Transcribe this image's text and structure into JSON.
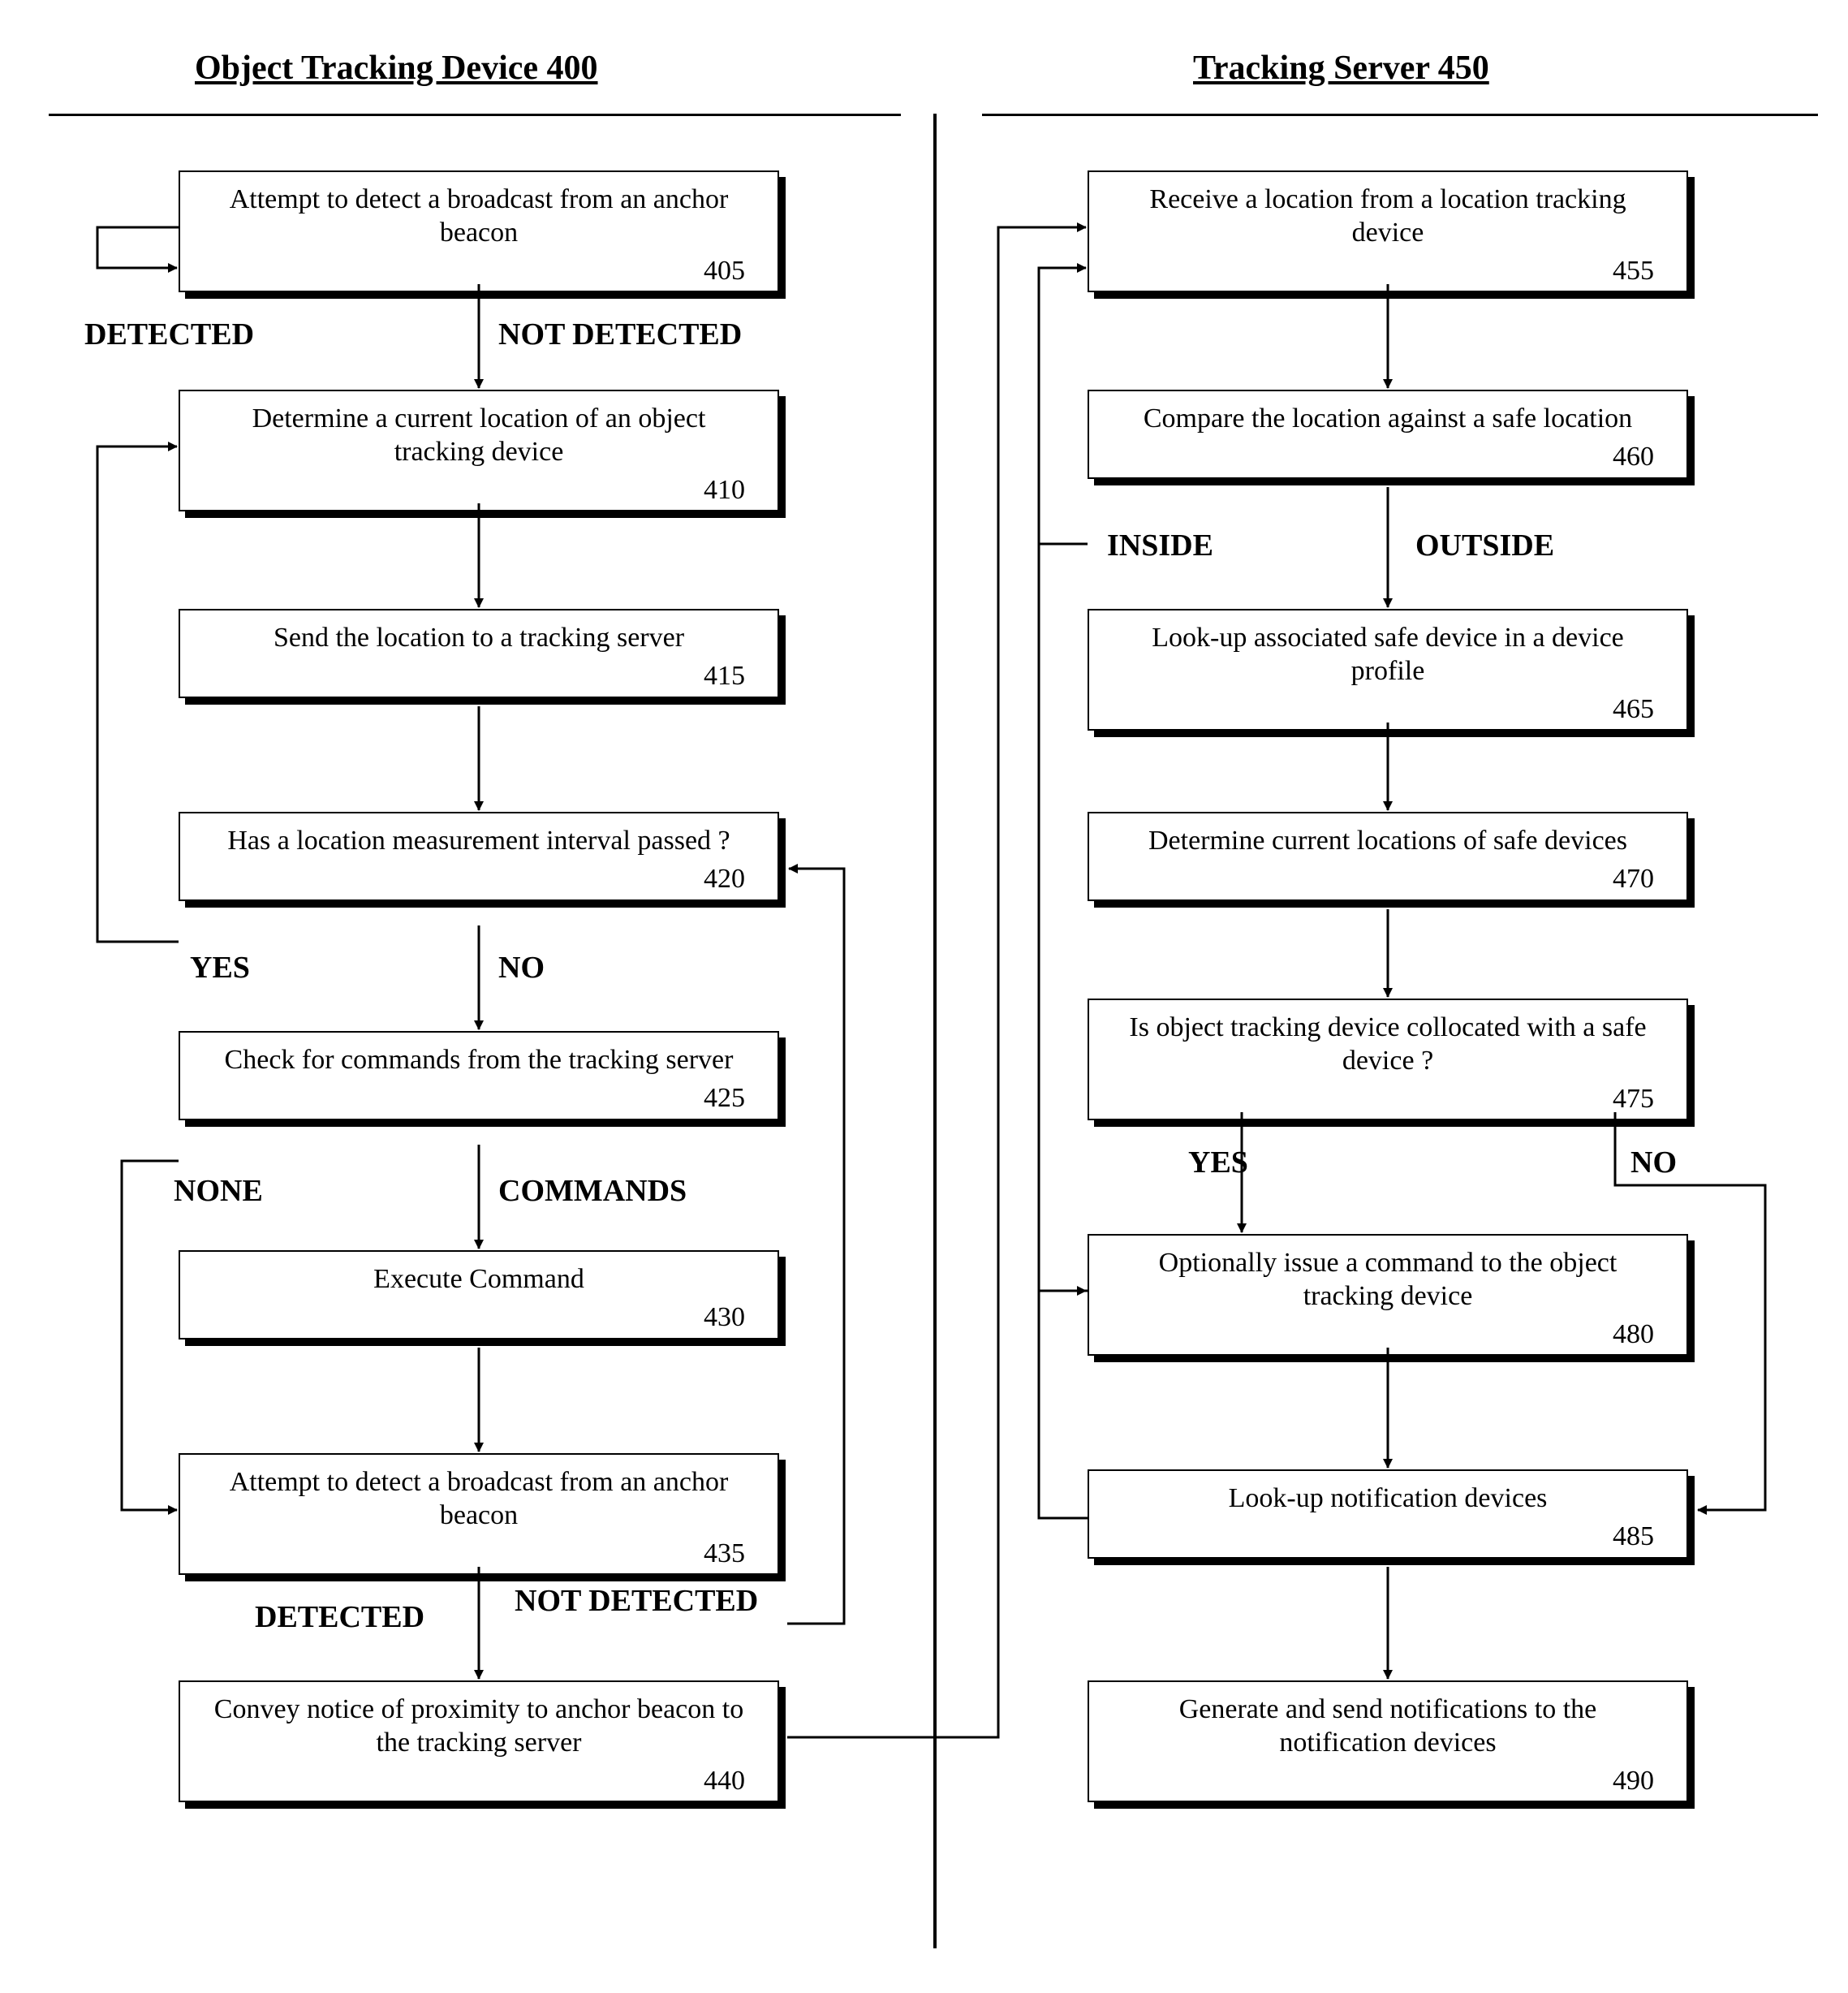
{
  "left_heading": "Object Tracking Device 400",
  "right_heading": "Tracking Server 450",
  "nodes": {
    "n405": {
      "text": "Attempt to detect a broadcast from an anchor beacon",
      "id": "405"
    },
    "n410": {
      "text": "Determine a current location of an object tracking device",
      "id": "410"
    },
    "n415": {
      "text": "Send the location to a tracking server",
      "id": "415"
    },
    "n420": {
      "text": "Has a location measurement interval passed ?",
      "id": "420"
    },
    "n425": {
      "text": "Check for commands from the tracking server",
      "id": "425"
    },
    "n430": {
      "text": "Execute Command",
      "id": "430"
    },
    "n435": {
      "text": "Attempt to detect a broadcast from an anchor beacon",
      "id": "435"
    },
    "n440": {
      "text": "Convey notice of proximity to anchor beacon to the tracking server",
      "id": "440"
    },
    "n455": {
      "text": "Receive a location from a location tracking device",
      "id": "455"
    },
    "n460": {
      "text": "Compare the location against a safe location",
      "id": "460"
    },
    "n465": {
      "text": "Look-up associated safe device in a device profile",
      "id": "465"
    },
    "n470": {
      "text": "Determine current locations of safe devices",
      "id": "470"
    },
    "n475": {
      "text": "Is object tracking device collocated with a safe device ?",
      "id": "475"
    },
    "n480": {
      "text": "Optionally issue a command to the object tracking device",
      "id": "480"
    },
    "n485": {
      "text": "Look-up notification devices",
      "id": "485"
    },
    "n490": {
      "text": "Generate and send notifications to the notification devices",
      "id": "490"
    }
  },
  "labels": {
    "detected1": "DETECTED",
    "not_detected1": "NOT DETECTED",
    "yes1": "YES",
    "no1": "NO",
    "none": "NONE",
    "commands": "COMMANDS",
    "detected2": "DETECTED",
    "not_detected2": "NOT DETECTED",
    "inside": "INSIDE",
    "outside": "OUTSIDE",
    "yes2": "YES",
    "no2": "NO"
  }
}
